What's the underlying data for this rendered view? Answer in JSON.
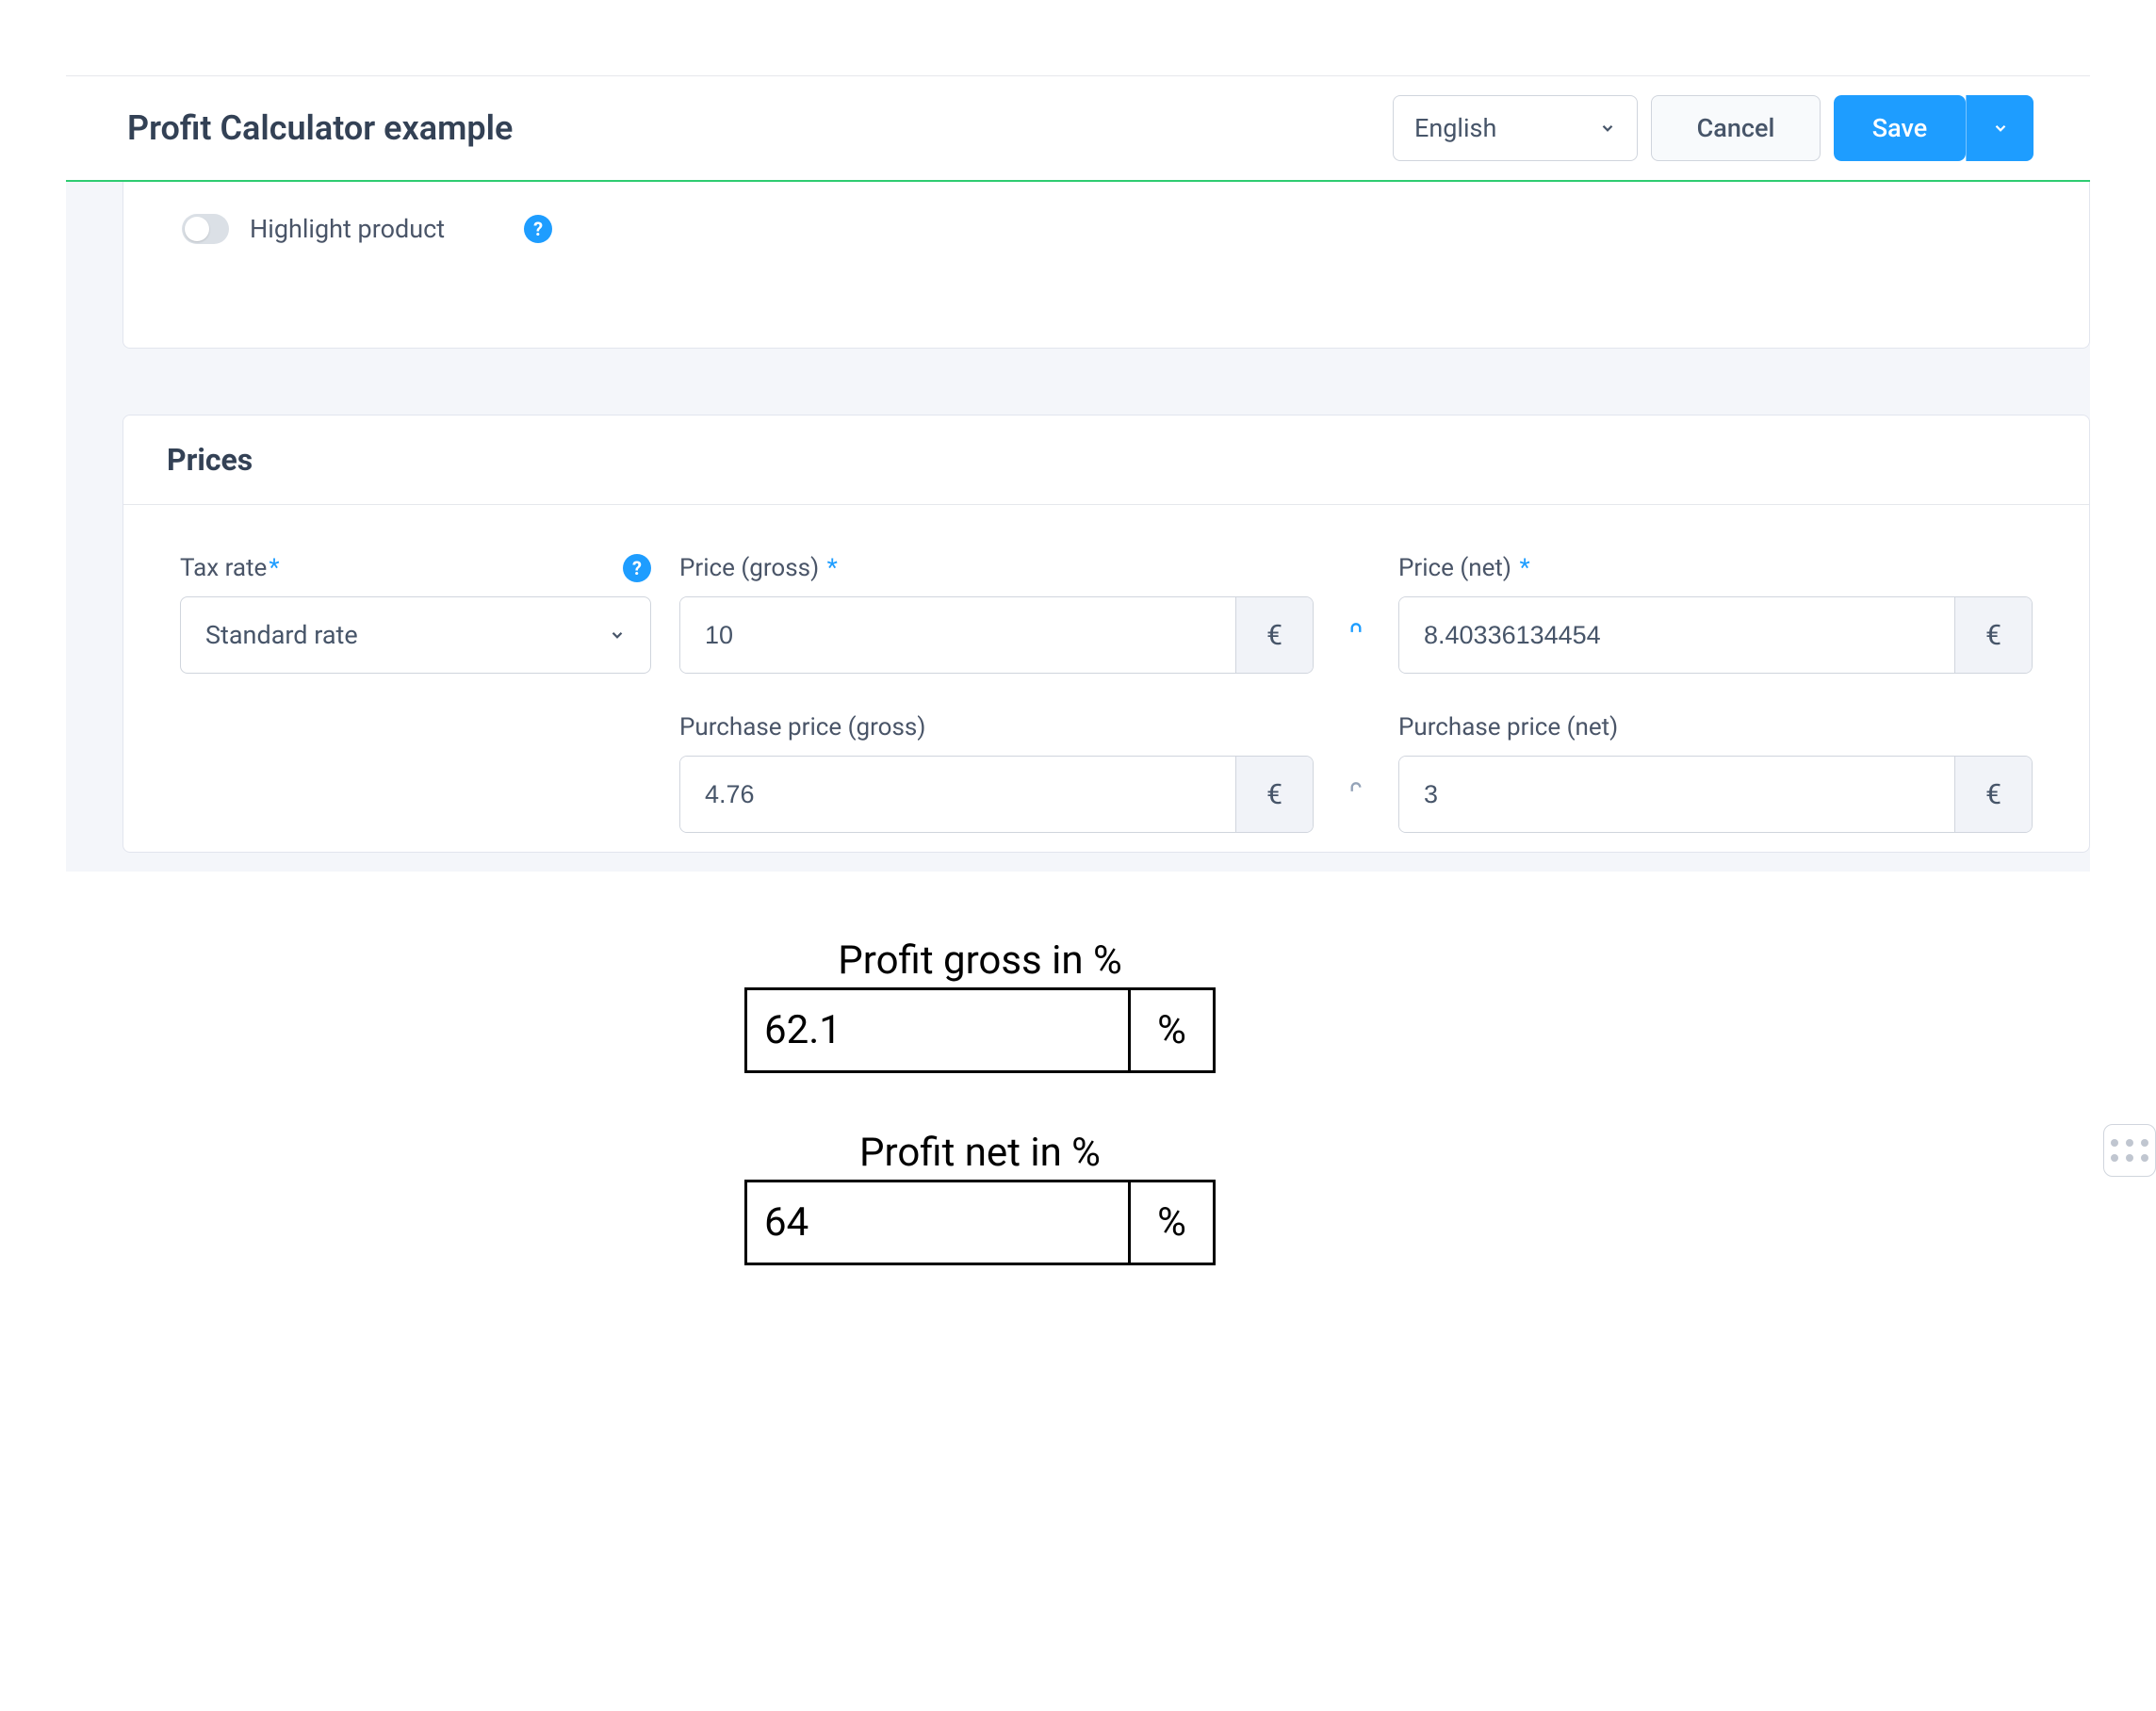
{
  "header": {
    "title": "Profit Calculator example",
    "language": "English",
    "cancel": "Cancel",
    "save": "Save"
  },
  "highlight": {
    "label": "Highlight product"
  },
  "prices": {
    "section_title": "Prices",
    "tax_rate_label": "Tax rate",
    "tax_rate_value": "Standard rate",
    "price_gross_label": "Price (gross)",
    "price_gross_value": "10",
    "price_net_label": "Price (net)",
    "price_net_value": "8.40336134454",
    "purchase_gross_label": "Purchase price (gross)",
    "purchase_gross_value": "4.76",
    "purchase_net_label": "Purchase price (net)",
    "purchase_net_value": "3",
    "currency": "€"
  },
  "illustration": {
    "profit_gross_title": "Profit gross in %",
    "profit_gross_value": "62.1",
    "profit_net_title": "Profit net in %",
    "profit_net_value": "64",
    "percent": "%"
  }
}
